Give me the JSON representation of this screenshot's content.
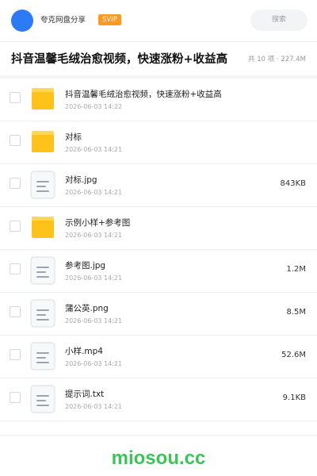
{
  "header": {
    "share_name": "夸克网盘分享",
    "badge": "SVIP",
    "search_label": "搜索"
  },
  "title_bar": {
    "title": "抖音温馨毛绒治愈视频，快速涨粉+收益高",
    "meta": "共 10 项 · 227.4M"
  },
  "files": [
    {
      "name": "抖音温馨毛绒治愈视频，快速涨粉+收益高",
      "date": "2026-06-03 14:22",
      "size": "",
      "icon": "folder-icon"
    },
    {
      "name": "对标",
      "date": "2026-06-03 14:21",
      "size": "",
      "icon": "folder-icon"
    },
    {
      "name": "对标.jpg",
      "date": "2026-06-03 14:21",
      "size": "843KB",
      "icon": "file-icon"
    },
    {
      "name": "示例小样+参考图",
      "date": "2026-06-03 14:21",
      "size": "",
      "icon": "folder-icon"
    },
    {
      "name": "参考图.jpg",
      "date": "2026-06-03 14:21",
      "size": "1.2M",
      "icon": "file-icon"
    },
    {
      "name": "蒲公英.png",
      "date": "2026-06-03 14:21",
      "size": "8.5M",
      "icon": "file-icon"
    },
    {
      "name": "小样.mp4",
      "date": "2026-06-03 14:21",
      "size": "52.6M",
      "icon": "file-icon"
    },
    {
      "name": "提示词.txt",
      "date": "2026-06-03 14:21",
      "size": "9.1KB",
      "icon": "file-icon"
    }
  ],
  "watermark": "miosou.cc",
  "colors": {
    "accent_blue": "#2d7af5",
    "badge_orange": "#ff9a1f",
    "folder_yellow": "#ffc21a",
    "folder_tab": "#ffd658",
    "watermark_green": "#3cc45a"
  }
}
